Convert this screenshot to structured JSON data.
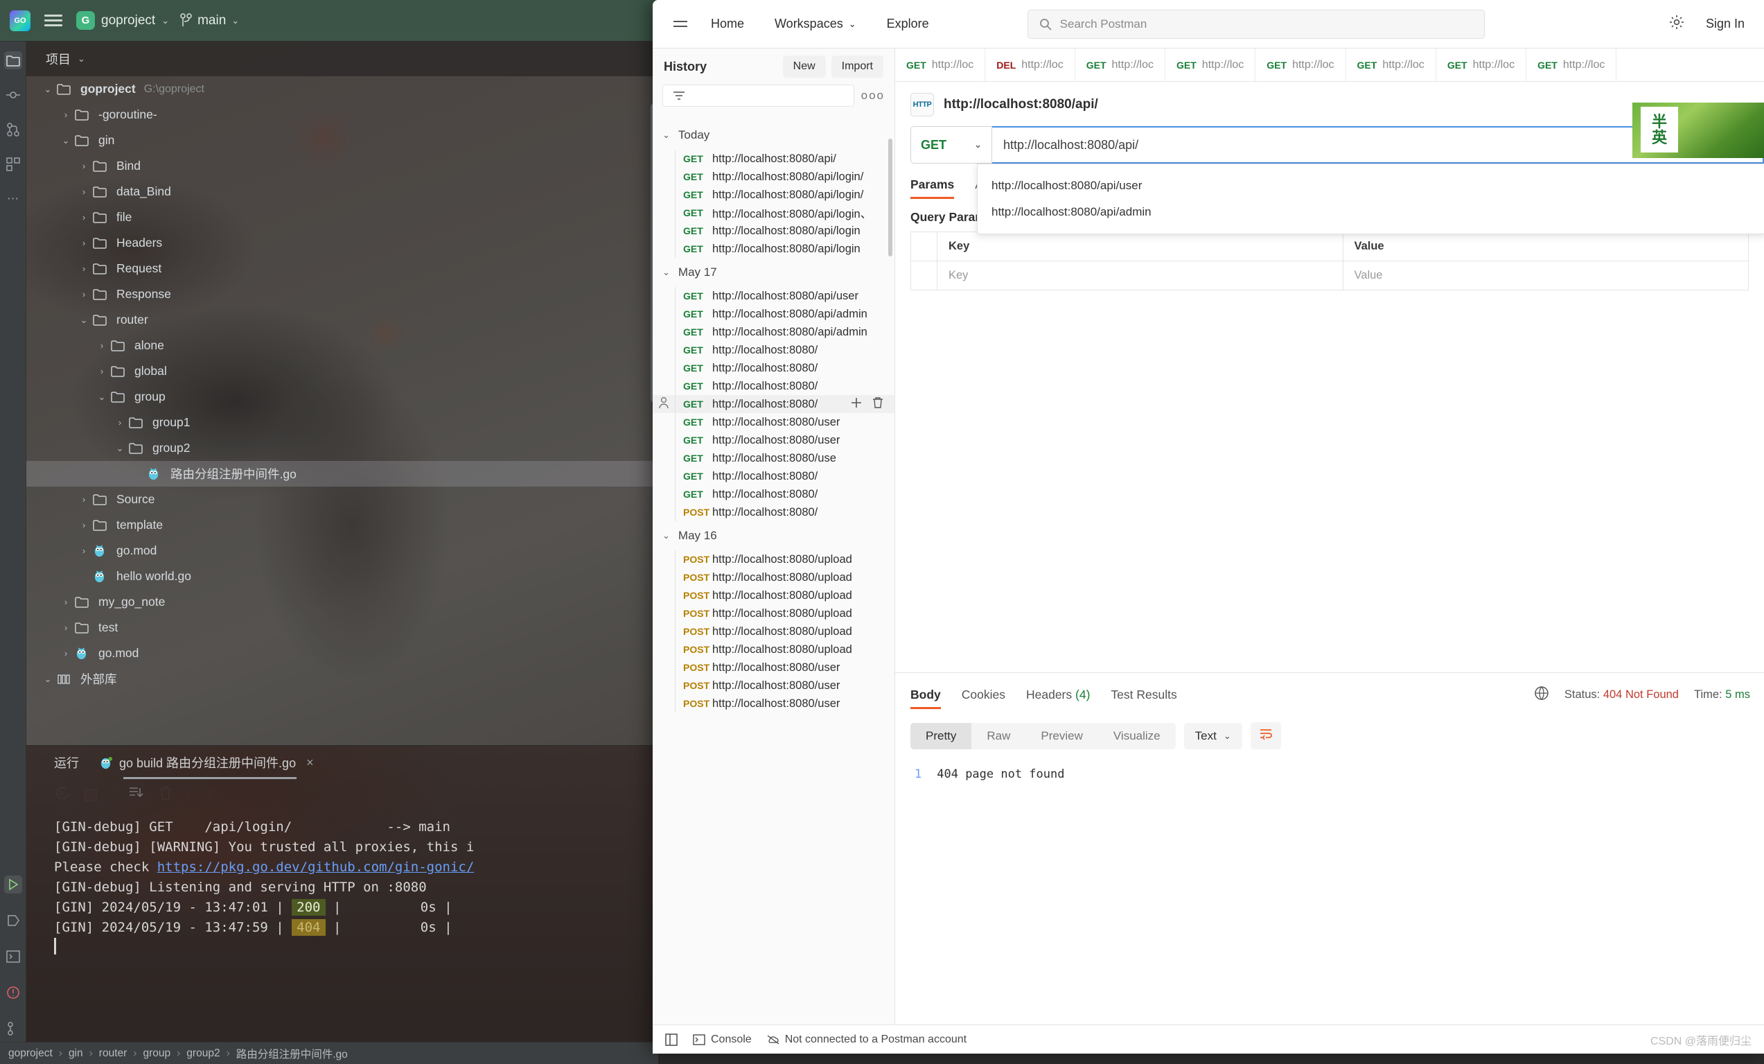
{
  "goland": {
    "title_project": "goproject",
    "branch": "main",
    "logo_text": "GO",
    "project_badge": "G",
    "panel_tab": "项目",
    "tree": [
      {
        "depth": 0,
        "arrow": "down",
        "icon": "folder",
        "name": "goproject",
        "path": "G:\\goproject",
        "bold": true
      },
      {
        "depth": 1,
        "arrow": "right",
        "icon": "folder",
        "name": "-goroutine-",
        "path": "",
        "bold": false
      },
      {
        "depth": 1,
        "arrow": "down",
        "icon": "folder",
        "name": "gin",
        "path": "",
        "bold": false
      },
      {
        "depth": 2,
        "arrow": "right",
        "icon": "folder",
        "name": "Bind",
        "path": "",
        "bold": false
      },
      {
        "depth": 2,
        "arrow": "right",
        "icon": "folder",
        "name": "data_Bind",
        "path": "",
        "bold": false
      },
      {
        "depth": 2,
        "arrow": "right",
        "icon": "folder",
        "name": "file",
        "path": "",
        "bold": false
      },
      {
        "depth": 2,
        "arrow": "right",
        "icon": "folder",
        "name": "Headers",
        "path": "",
        "bold": false
      },
      {
        "depth": 2,
        "arrow": "right",
        "icon": "folder",
        "name": "Request",
        "path": "",
        "bold": false
      },
      {
        "depth": 2,
        "arrow": "right",
        "icon": "folder",
        "name": "Response",
        "path": "",
        "bold": false
      },
      {
        "depth": 2,
        "arrow": "down",
        "icon": "folder",
        "name": "router",
        "path": "",
        "bold": false
      },
      {
        "depth": 3,
        "arrow": "right",
        "icon": "folder",
        "name": "alone",
        "path": "",
        "bold": false
      },
      {
        "depth": 3,
        "arrow": "right",
        "icon": "folder",
        "name": "global",
        "path": "",
        "bold": false
      },
      {
        "depth": 3,
        "arrow": "down",
        "icon": "folder",
        "name": "group",
        "path": "",
        "bold": false
      },
      {
        "depth": 4,
        "arrow": "right",
        "icon": "folder",
        "name": "group1",
        "path": "",
        "bold": false
      },
      {
        "depth": 4,
        "arrow": "down",
        "icon": "folder",
        "name": "group2",
        "path": "",
        "bold": false
      },
      {
        "depth": 5,
        "arrow": "none",
        "icon": "gopher",
        "name": "路由分组注册中间件.go",
        "path": "",
        "bold": false,
        "selected": true
      },
      {
        "depth": 2,
        "arrow": "right",
        "icon": "folder",
        "name": "Source",
        "path": "",
        "bold": false
      },
      {
        "depth": 2,
        "arrow": "right",
        "icon": "folder",
        "name": "template",
        "path": "",
        "bold": false
      },
      {
        "depth": 2,
        "arrow": "right",
        "icon": "gopher",
        "name": "go.mod",
        "path": "",
        "bold": false
      },
      {
        "depth": 2,
        "arrow": "none",
        "icon": "gopher",
        "name": "hello world.go",
        "path": "",
        "bold": false
      },
      {
        "depth": 1,
        "arrow": "right",
        "icon": "folder",
        "name": "my_go_note",
        "path": "",
        "bold": false
      },
      {
        "depth": 1,
        "arrow": "right",
        "icon": "folder",
        "name": "test",
        "path": "",
        "bold": false
      },
      {
        "depth": 1,
        "arrow": "right",
        "icon": "gopher",
        "name": "go.mod",
        "path": "",
        "bold": false
      },
      {
        "depth": 0,
        "arrow": "down",
        "icon": "library",
        "name": "外部库",
        "path": "",
        "bold": false
      }
    ],
    "run": {
      "tab_label": "运行",
      "config_name": "go build 路由分组注册中间件.go",
      "close": "×",
      "console_lines": [
        "[GIN-debug] GET    /api/login/            --> main",
        "[GIN-debug] [WARNING] You trusted all proxies, this i",
        "Please check https://pkg.go.dev/github.com/gin-gonic/",
        "[GIN-debug] Listening and serving HTTP on :8080",
        "[GIN] 2024/05/19 - 13:47:01 | 200 |          0s |",
        "[GIN] 2024/05/19 - 13:47:59 | 404 |          0s |"
      ],
      "link_text": "https://pkg.go.dev/github.com/gin-gonic/",
      "code_200": "200",
      "code_404": "404"
    },
    "statusbar": [
      "goproject",
      "gin",
      "router",
      "group",
      "group2",
      "路由分组注册中间件.go"
    ]
  },
  "postman": {
    "nav": {
      "home": "Home",
      "workspaces": "Workspaces",
      "explore": "Explore",
      "search_placeholder": "Search Postman",
      "sign_in": "Sign In",
      "settings_icon": "gear-icon",
      "hamburger_icon": "hamburger-icon"
    },
    "sidebar": {
      "title": "History",
      "new_label": "New",
      "import_label": "Import",
      "more_icon": "more-options-icon",
      "filter_icon": "filter-icon",
      "groups": [
        {
          "label": "Today",
          "items": [
            {
              "method": "GET",
              "url": "http://localhost:8080/api/"
            },
            {
              "method": "GET",
              "url": "http://localhost:8080/api/login/"
            },
            {
              "method": "GET",
              "url": "http://localhost:8080/api/login/"
            },
            {
              "method": "GET",
              "url": "http://localhost:8080/api/login、"
            },
            {
              "method": "GET",
              "url": "http://localhost:8080/api/login"
            },
            {
              "method": "GET",
              "url": "http://localhost:8080/api/login"
            }
          ]
        },
        {
          "label": "May 17",
          "items": [
            {
              "method": "GET",
              "url": "http://localhost:8080/api/user"
            },
            {
              "method": "GET",
              "url": "http://localhost:8080/api/admin"
            },
            {
              "method": "GET",
              "url": "http://localhost:8080/api/admin"
            },
            {
              "method": "GET",
              "url": "http://localhost:8080/"
            },
            {
              "method": "GET",
              "url": "http://localhost:8080/"
            },
            {
              "method": "GET",
              "url": "http://localhost:8080/"
            },
            {
              "method": "GET",
              "url": "http://localhost:8080/",
              "hover": true
            },
            {
              "method": "GET",
              "url": "http://localhost:8080/user"
            },
            {
              "method": "GET",
              "url": "http://localhost:8080/user"
            },
            {
              "method": "GET",
              "url": "http://localhost:8080/use"
            },
            {
              "method": "GET",
              "url": "http://localhost:8080/"
            },
            {
              "method": "GET",
              "url": "http://localhost:8080/"
            },
            {
              "method": "POST",
              "url": "http://localhost:8080/"
            }
          ]
        },
        {
          "label": "May 16",
          "items": [
            {
              "method": "POST",
              "url": "http://localhost:8080/upload"
            },
            {
              "method": "POST",
              "url": "http://localhost:8080/upload"
            },
            {
              "method": "POST",
              "url": "http://localhost:8080/upload"
            },
            {
              "method": "POST",
              "url": "http://localhost:8080/upload"
            },
            {
              "method": "POST",
              "url": "http://localhost:8080/upload"
            },
            {
              "method": "POST",
              "url": "http://localhost:8080/upload"
            },
            {
              "method": "POST",
              "url": "http://localhost:8080/user"
            },
            {
              "method": "POST",
              "url": "http://localhost:8080/user"
            },
            {
              "method": "POST",
              "url": "http://localhost:8080/user"
            }
          ]
        }
      ],
      "row_add_icon": "plus-icon",
      "row_delete_icon": "trash-icon",
      "row_person_icon": "person-icon"
    },
    "request_tabs": [
      {
        "method": "GET",
        "label": "http://loc"
      },
      {
        "method": "DEL",
        "label": "http://loc"
      },
      {
        "method": "GET",
        "label": "http://loc"
      },
      {
        "method": "GET",
        "label": "http://loc"
      },
      {
        "method": "GET",
        "label": "http://loc"
      },
      {
        "method": "GET",
        "label": "http://loc"
      },
      {
        "method": "GET",
        "label": "http://loc"
      },
      {
        "method": "GET",
        "label": "http://loc"
      }
    ],
    "request": {
      "protocol_icon": "HTTP",
      "title": "http://localhost:8080/api/",
      "method": "GET",
      "url_value": "http://localhost:8080/api/",
      "suggestions": [
        "http://localhost:8080/api/user",
        "http://localhost:8080/api/admin"
      ],
      "tabs": [
        "Params",
        "Authoriz"
      ],
      "active_tab": "Params",
      "query_params_label": "Query Params",
      "table": {
        "headers": [
          "Key",
          "Value"
        ],
        "rows": [
          [
            "Key",
            "Value"
          ]
        ]
      }
    },
    "response": {
      "tabs": [
        "Body",
        "Cookies",
        "Headers",
        "Test Results"
      ],
      "headers_count": "(4)",
      "active_tab": "Body",
      "status_label": "Status:",
      "status_value": "404 Not Found",
      "time_label": "Time:",
      "time_value": "5 ms",
      "globe_icon": "globe-icon",
      "formats": [
        "Pretty",
        "Raw",
        "Preview",
        "Visualize"
      ],
      "active_format": "Pretty",
      "type": "Text",
      "wrap_icon": "wrap-lines-icon",
      "line_number": "1",
      "body_text": "404 page not found"
    },
    "statusbar": {
      "layout_icon": "layout-icon",
      "console_label": "Console",
      "account_text": "Not connected to a Postman account",
      "watermark": "CSDN @落雨便归尘"
    }
  },
  "colors": {
    "accent_orange": "#ef5b25",
    "get_green": "#1a7f37",
    "post_amber": "#b58000",
    "delete_red": "#a11616",
    "error_red": "#c1392b",
    "focus_blue": "#4a90e2",
    "goland_header": "#3b5447"
  }
}
